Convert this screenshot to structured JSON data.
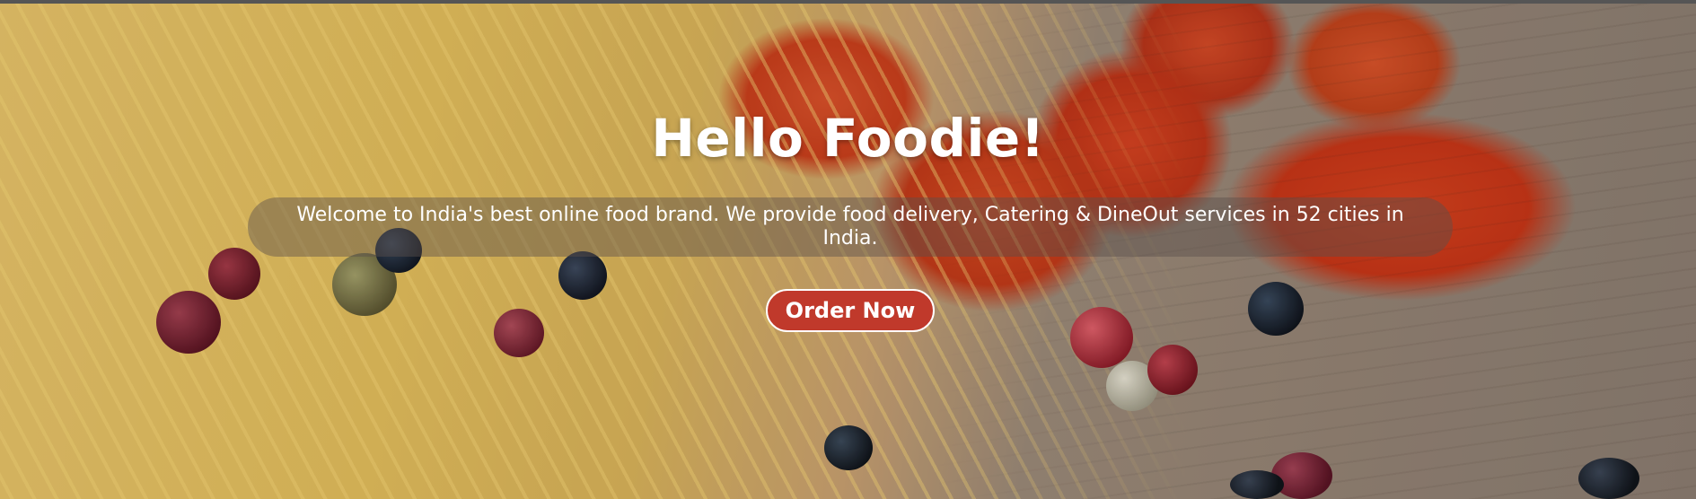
{
  "hero": {
    "title": "Hello Foodie!",
    "tagline": "Welcome to India's best online food brand. We provide food delivery, Catering & DineOut services in 52 cities in India.",
    "cta_label": "Order Now"
  },
  "colors": {
    "cta_background": "#c0392b",
    "text": "#ffffff"
  }
}
